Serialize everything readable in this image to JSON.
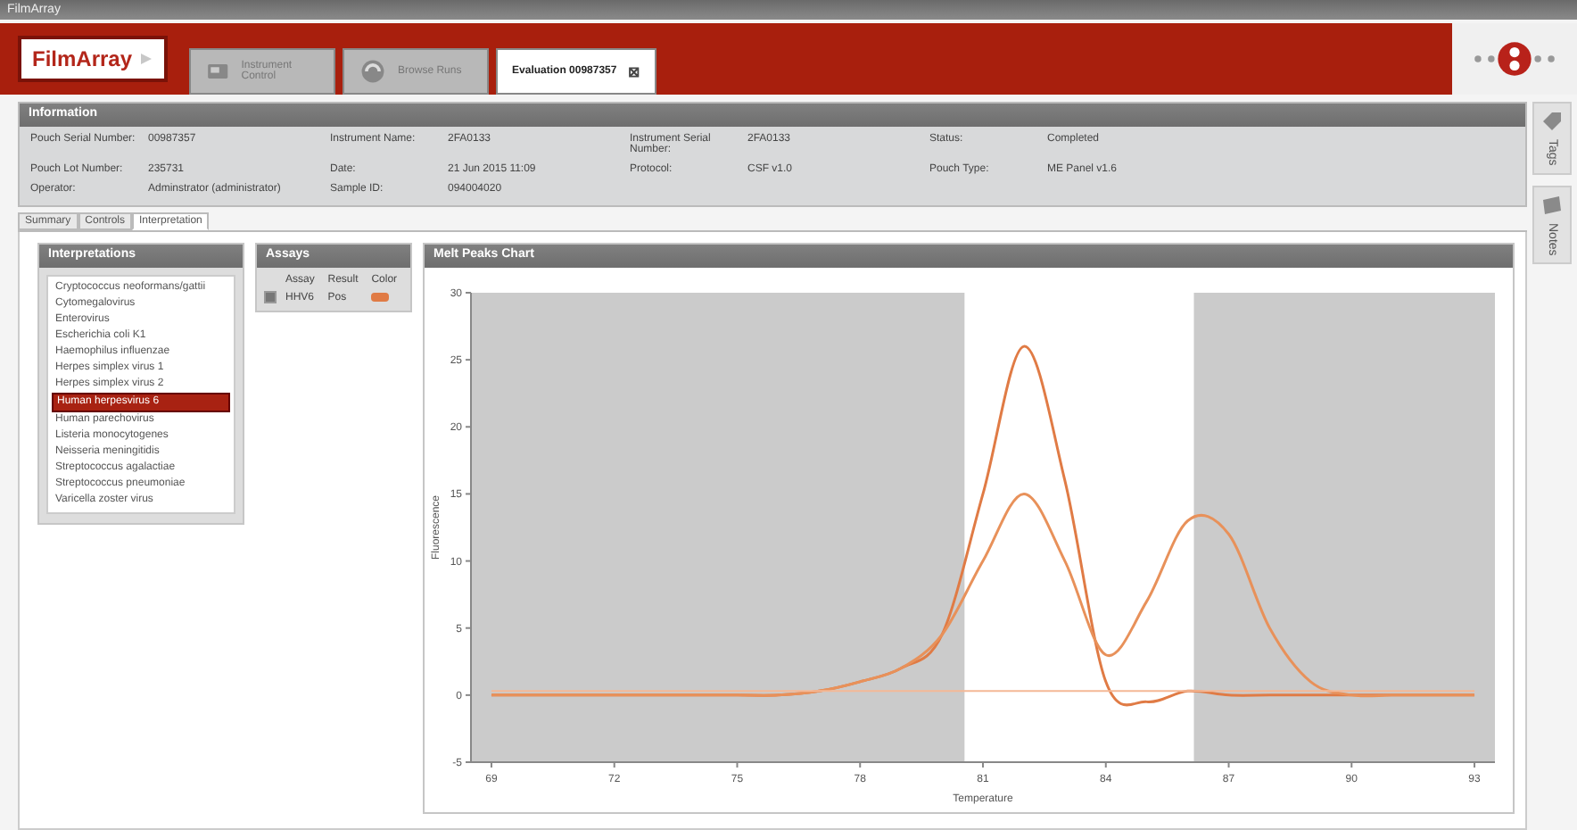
{
  "window": {
    "title": "FilmArray"
  },
  "header": {
    "logo": "FilmArray",
    "tabs": [
      {
        "label": "Instrument Control",
        "selected": false
      },
      {
        "label": "Browse Runs",
        "selected": false
      },
      {
        "label": "Evaluation 00987357",
        "selected": true,
        "close": "⊠"
      }
    ]
  },
  "information": {
    "title": "Information",
    "fields": [
      {
        "label": "Pouch Serial Number:",
        "value": "00987357"
      },
      {
        "label": "Instrument Name:",
        "value": "2FA0133"
      },
      {
        "label": "Instrument Serial Number:",
        "value": "2FA0133"
      },
      {
        "label": "Status:",
        "value": "Completed"
      },
      {
        "label": "Pouch Lot Number:",
        "value": "235731"
      },
      {
        "label": "Date:",
        "value": "21 Jun 2015 11:09"
      },
      {
        "label": "Protocol:",
        "value": "CSF v1.0"
      },
      {
        "label": "Pouch Type:",
        "value": "ME Panel v1.6"
      },
      {
        "label": "Operator:",
        "value": "Adminstrator (administrator)"
      },
      {
        "label": "Sample ID:",
        "value": "094004020"
      }
    ]
  },
  "tabs": [
    {
      "label": "Summary",
      "selected": false
    },
    {
      "label": "Controls",
      "selected": false
    },
    {
      "label": "Interpretation",
      "selected": true
    }
  ],
  "interpretations": {
    "title": "Interpretations",
    "items": [
      {
        "label": "Cryptococcus neoformans/gattii",
        "selected": false
      },
      {
        "label": "Cytomegalovirus",
        "selected": false
      },
      {
        "label": "Enterovirus",
        "selected": false
      },
      {
        "label": "Escherichia coli K1",
        "selected": false
      },
      {
        "label": "Haemophilus influenzae",
        "selected": false
      },
      {
        "label": "Herpes simplex virus 1",
        "selected": false
      },
      {
        "label": "Herpes simplex virus 2",
        "selected": false
      },
      {
        "label": "Human herpesvirus 6",
        "selected": true
      },
      {
        "label": "Human parechovirus",
        "selected": false
      },
      {
        "label": "Listeria monocytogenes",
        "selected": false
      },
      {
        "label": "Neisseria meningitidis",
        "selected": false
      },
      {
        "label": "Streptococcus agalactiae",
        "selected": false
      },
      {
        "label": "Streptococcus pneumoniae",
        "selected": false
      },
      {
        "label": "Varicella zoster virus",
        "selected": false
      }
    ]
  },
  "assays": {
    "title": "Assays",
    "columns": [
      "Assay",
      "Result",
      "Color"
    ],
    "rows": [
      {
        "assay": "HHV6",
        "result": "Pos",
        "checked": true,
        "color": "#e07b45"
      }
    ]
  },
  "melt_chart": {
    "title": "Melt Peaks Chart",
    "chart_data": {
      "type": "line",
      "xlabel": "Temperature",
      "ylabel": "Fluorescence",
      "x": [
        69,
        70,
        71,
        72,
        73,
        74,
        75,
        76,
        77,
        78,
        79,
        80,
        81,
        82,
        83,
        84,
        85,
        86,
        87,
        88,
        89,
        90,
        91,
        92,
        93
      ],
      "xlim": [
        68.5,
        93.5
      ],
      "ylim": [
        -5,
        30
      ],
      "xticks": [
        69,
        72,
        75,
        78,
        81,
        84,
        87,
        90,
        93
      ],
      "yticks": [
        -5,
        0,
        5,
        10,
        15,
        20,
        25,
        30
      ],
      "series": [
        {
          "color": "#e07b45",
          "values": [
            0,
            0,
            0,
            0,
            0,
            0,
            0,
            0,
            0.3,
            1,
            2,
            4.5,
            15,
            26,
            16,
            1,
            -0.5,
            0.3,
            0,
            0,
            0,
            0,
            0,
            0,
            0
          ]
        },
        {
          "color": "#e8915a",
          "values": [
            0,
            0,
            0,
            0,
            0,
            0,
            0,
            0,
            0.3,
            1,
            2,
            4.5,
            10,
            15,
            10,
            3,
            7,
            13,
            12,
            5,
            1,
            0,
            0,
            0,
            0
          ]
        },
        {
          "color": "#f4b896",
          "values": [
            0.3,
            0.3,
            0.3,
            0.3,
            0.3,
            0.3,
            0.3,
            0.3,
            0.3,
            0.3,
            0.3,
            0.3,
            0.3,
            0.3,
            0.3,
            0.3,
            0.3,
            0.3,
            0.3,
            0.3,
            0.3,
            0.3,
            0.3,
            0.3,
            0.3
          ]
        }
      ]
    }
  },
  "side_tabs": [
    {
      "label": "Tags"
    },
    {
      "label": "Notes"
    }
  ]
}
